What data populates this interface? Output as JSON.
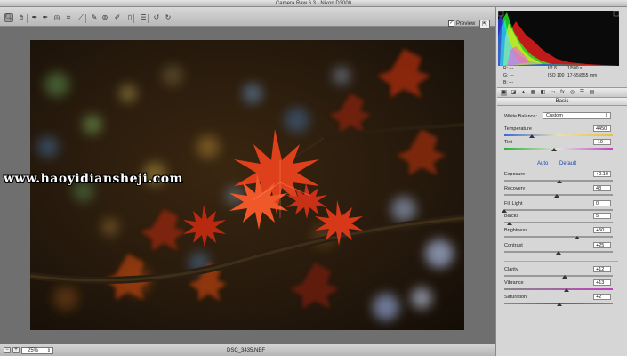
{
  "app": {
    "title": "Camera Raw 6.3  -  Nikon D3000"
  },
  "toolbar": {
    "tools": [
      {
        "name": "zoom-tool",
        "glyph": "🔍︎",
        "active": true
      },
      {
        "name": "hand-tool",
        "glyph": "✋︎"
      },
      {
        "name": "white-balance-tool",
        "glyph": "✒"
      },
      {
        "name": "color-sampler-tool",
        "glyph": "✒"
      },
      {
        "name": "targeted-adjustment-tool",
        "glyph": "◎"
      },
      {
        "name": "crop-tool",
        "glyph": "⌗"
      },
      {
        "name": "straighten-tool",
        "glyph": "⟋"
      },
      {
        "name": "spot-removal-tool",
        "glyph": "✎"
      },
      {
        "name": "red-eye-tool",
        "glyph": "⊚"
      },
      {
        "name": "adjustment-brush-tool",
        "glyph": "✐"
      },
      {
        "name": "graduated-filter-tool",
        "glyph": "▯"
      },
      {
        "name": "preferences-tool",
        "glyph": "☰"
      },
      {
        "name": "rotate-ccw-tool",
        "glyph": "↺"
      },
      {
        "name": "rotate-cw-tool",
        "glyph": "↻"
      }
    ],
    "preview_label": "Preview",
    "preview_checked": "✓",
    "fullscreen_glyph": "⇱"
  },
  "watermark": "www.haoyidiansheji.com",
  "bottombar": {
    "zoom_minus": "−",
    "zoom_plus": "+",
    "zoom_value": "25%",
    "zoom_arrow": "⇕",
    "filename": "DSC_3435.NEF"
  },
  "histogram": {
    "colors": {
      "red": "#ff2020",
      "green": "#20ff20",
      "blue": "#3040ff",
      "cyan": "#30ffff",
      "magenta": "#ff40ff",
      "yellow": "#ffff30"
    }
  },
  "info": {
    "r_label": "R:",
    "r_value": "---",
    "g_label": "G:",
    "g_value": "---",
    "b_label": "B:",
    "b_value": "---",
    "aperture": "f/2.8",
    "shutter": "1/500 s",
    "iso": "ISO 100",
    "lens": "17-55@55 mm"
  },
  "tabs": [
    "basic-tab",
    "tone-curve-tab",
    "detail-tab",
    "hsl-tab",
    "split-toning-tab",
    "lens-tab",
    "effects-tab",
    "camera-calibration-tab",
    "presets-tab",
    "snapshots-tab"
  ],
  "panel": {
    "title": "Basic",
    "white_balance_label": "White Balance:",
    "white_balance_value": "Custom",
    "auto_label": "Auto",
    "default_label": "Default",
    "sliders": [
      {
        "label": "Temperature",
        "value": "4450",
        "fraction": 0.25
      },
      {
        "label": "Tint",
        "value": "-10",
        "fraction": 0.46
      },
      {
        "label": "Exposure",
        "value": "+0.10",
        "fraction": 0.51
      },
      {
        "label": "Recovery",
        "value": "48",
        "fraction": 0.48
      },
      {
        "label": "Fill Light",
        "value": "0",
        "fraction": 0.0
      },
      {
        "label": "Blacks",
        "value": "5",
        "fraction": 0.05
      },
      {
        "label": "Brightness",
        "value": "+50",
        "fraction": 0.67
      },
      {
        "label": "Contrast",
        "value": "+25",
        "fraction": 0.5
      },
      {
        "label": "Clarity",
        "value": "+12",
        "fraction": 0.56
      },
      {
        "label": "Vibrance",
        "value": "+13",
        "fraction": 0.57
      },
      {
        "label": "Saturation",
        "value": "+2",
        "fraction": 0.51
      }
    ]
  }
}
